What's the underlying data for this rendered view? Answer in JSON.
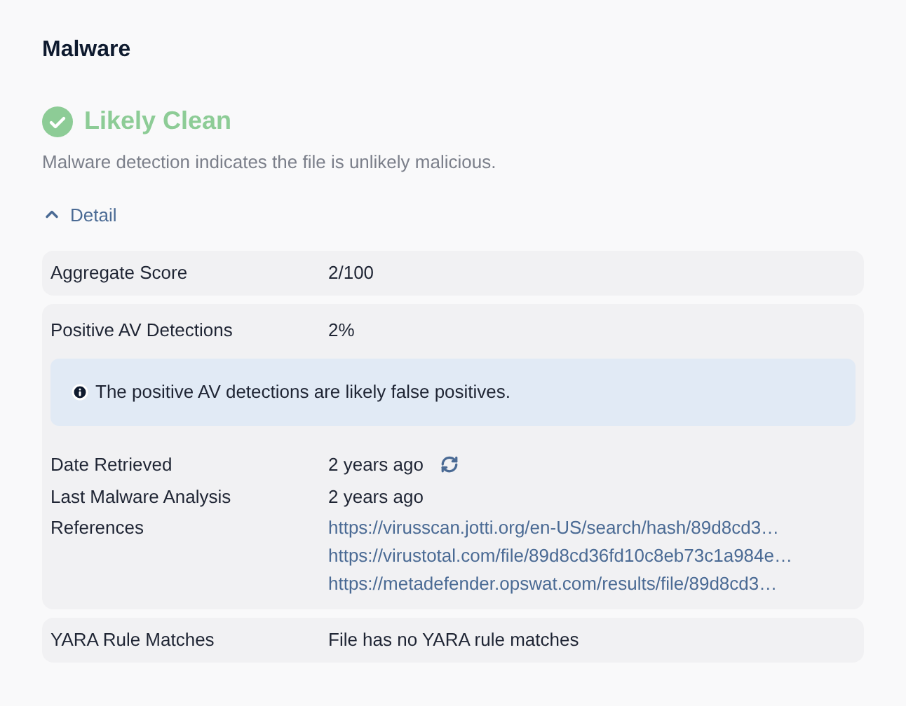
{
  "section": {
    "title": "Malware"
  },
  "verdict": {
    "label": "Likely Clean",
    "description": "Malware detection indicates the file is unlikely malicious."
  },
  "detail_toggle": {
    "label": "Detail",
    "expanded": true
  },
  "rows": [
    {
      "kind": "plain",
      "label": "Aggregate Score",
      "value": "2/100"
    },
    {
      "kind": "group",
      "label": "Positive AV Detections",
      "value": "2%",
      "notice": "The positive AV detections are likely false positives.",
      "fields": [
        {
          "kind": "refresh",
          "label": "Date Retrieved",
          "value": "2 years ago"
        },
        {
          "kind": "text",
          "label": "Last Malware Analysis",
          "value": "2 years ago"
        },
        {
          "kind": "links",
          "label": "References",
          "links": [
            "https://virusscan.jotti.org/en-US/search/hash/89d8cd3…",
            "https://virustotal.com/file/89d8cd36fd10c8eb73c1a984e…",
            "https://metadefender.opswat.com/results/file/89d8cd3…"
          ]
        }
      ]
    },
    {
      "kind": "plain",
      "label": "YARA Rule Matches",
      "value": "File has no YARA rule matches"
    }
  ]
}
